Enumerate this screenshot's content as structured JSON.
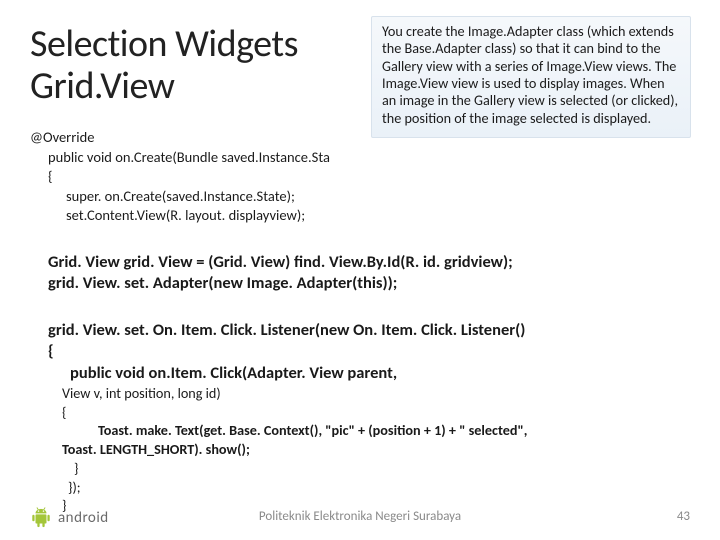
{
  "title_line1": "Selection Widgets",
  "title_line2": "Grid.View",
  "callout": "You create the Image.Adapter class (which extends the Base.Adapter class) so that it can bind to the Gallery view with a series of Image.View views.\nThe Image.View view is used to display images. When an image in the Gallery view is selected (or clicked), the position of the image selected is displayed.",
  "code1": {
    "l1": "@Override",
    "l2": "public void on.Create(Bundle saved.Instance.Sta",
    "l3": "{",
    "l4a": "super. on.Create(saved.Instance.State);",
    "l4b": "set.Content.View(R. layout. displayview);"
  },
  "code2": {
    "l1": "Grid. View grid. View = (Grid. View) find. View.By.Id(R. id. gridview);",
    "l2": "grid. View. set. Adapter(new Image. Adapter(this));"
  },
  "code3": {
    "l1": "grid. View. set. On. Item. Click. Listener(new On. Item. Click. Listener()",
    "l2": "{",
    "l3": "public void on.Item. Click(Adapter. View parent,"
  },
  "code4": {
    "l1": "View v, int position, long id)",
    "l2": "{",
    "l3": "Toast. make. Text(get. Base. Context(),   \"pic\" + (position + 1) + \" selected\",",
    "l4": "Toast. LENGTH_SHORT). show();",
    "l5": "}",
    "l6": "});",
    "l7": "}"
  },
  "footer": {
    "logo_text": "android",
    "center": "Politeknik Elektronika Negeri Surabaya",
    "page": "43"
  }
}
